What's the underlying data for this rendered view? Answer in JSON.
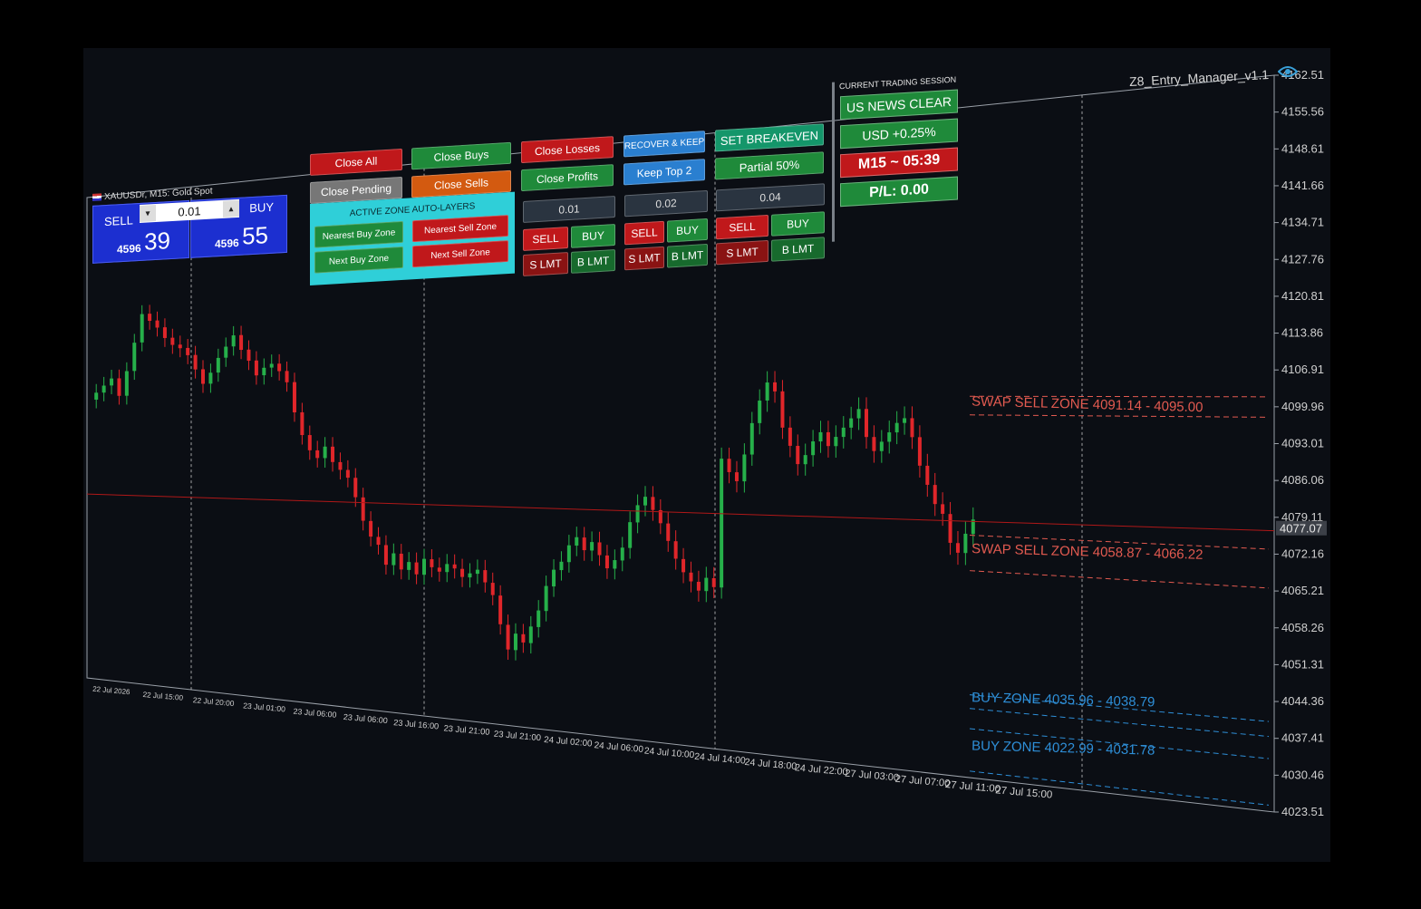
{
  "window": {
    "title": "Z8_Entry_Manager_v1.1",
    "symbol_header": "XAUUSDr, M15:  Gold Spot"
  },
  "one_click": {
    "sell_label": "SELL",
    "buy_label": "BUY",
    "lot": "0.01",
    "sell_small": "4596",
    "sell_big": "39",
    "buy_small": "4596",
    "buy_big": "55",
    "minus": "▾",
    "plus": "▴"
  },
  "panel": {
    "close_all": "Close All",
    "close_pending": "Close Pending",
    "close_buys": "Close Buys",
    "close_sells": "Close Sells",
    "close_losses": "Close Losses",
    "close_profits": "Close Profits",
    "recover_keep": "RECOVER & KEEP",
    "keep_top": "Keep Top 2",
    "set_breakeven": "SET BREAKEVEN",
    "partial": "Partial 50%",
    "zone_title": "ACTIVE ZONE AUTO-LAYERS",
    "nearest_buy": "Nearest Buy Zone",
    "nearest_sell": "Nearest Sell Zone",
    "next_buy": "Next Buy Zone",
    "next_sell": "Next Sell Zone",
    "lots": [
      {
        "lot": "0.01",
        "sell": "SELL",
        "buy": "BUY",
        "slmt": "S LMT",
        "blmt": "B LMT"
      },
      {
        "lot": "0.02",
        "sell": "SELL",
        "buy": "BUY",
        "slmt": "S LMT",
        "blmt": "B LMT"
      },
      {
        "lot": "0.04",
        "sell": "SELL",
        "buy": "BUY",
        "slmt": "S LMT",
        "blmt": "B LMT"
      }
    ],
    "session_title": "CURRENT TRADING SESSION",
    "news": "US NEWS CLEAR",
    "usd": "USD +0.25%",
    "timer": "M15 ~ 05:39",
    "pl": "P/L: 0.00"
  },
  "colors": {
    "bull": "#26b04a",
    "bear": "#e0262a",
    "sell_zone": "#e25a50",
    "buy_zone": "#2e8fd8",
    "price_line": "#b01818"
  },
  "chart_data": {
    "type": "candlestick",
    "current_price": "4077.07",
    "y_ticks": [
      "4162.51",
      "4155.56",
      "4148.61",
      "4141.66",
      "4134.71",
      "4127.76",
      "4120.81",
      "4113.86",
      "4106.91",
      "4099.96",
      "4093.01",
      "4086.06",
      "4079.11",
      "4072.16",
      "4065.21",
      "4058.26",
      "4051.31",
      "4044.36",
      "4037.41",
      "4030.46",
      "4023.51"
    ],
    "x_ticks": [
      "22 Jul 2026",
      "22 Jul 15:00",
      "22 Jul 20:00",
      "23 Jul 01:00",
      "23 Jul 06:00",
      "23 Jul 06:00",
      "23 Jul 16:00",
      "23 Jul 21:00",
      "23 Jul 21:00",
      "24 Jul 02:00",
      "24 Jul 06:00",
      "24 Jul 10:00",
      "24 Jul 14:00",
      "24 Jul 18:00",
      "24 Jul 22:00",
      "27 Jul 03:00",
      "27 Jul 07:00",
      "27 Jul 11:00",
      "27 Jul 15:00"
    ],
    "zones": [
      {
        "label": "SWAP SELL ZONE 4091.14 - 4095.00",
        "kind": "sell",
        "low": 4091.14,
        "high": 4095.0
      },
      {
        "label": "SWAP SELL ZONE 4058.87 - 4066.22",
        "kind": "sell",
        "low": 4058.87,
        "high": 4066.22
      },
      {
        "label": "BUY ZONE 4035.96 - 4038.79",
        "kind": "buy",
        "low": 4035.96,
        "high": 4038.79
      },
      {
        "label": "BUY ZONE 4022.99 - 4031.78",
        "kind": "buy",
        "low": 4022.99,
        "high": 4031.78
      }
    ],
    "closes": [
      4106,
      4108,
      4110,
      4105,
      4112,
      4120,
      4128,
      4126,
      4124,
      4121,
      4119,
      4118,
      4116,
      4112,
      4108,
      4111,
      4115,
      4118,
      4121,
      4117,
      4114,
      4110,
      4112,
      4113,
      4111,
      4108,
      4100,
      4094,
      4090,
      4088,
      4091,
      4087,
      4085,
      4083,
      4078,
      4072,
      4068,
      4066,
      4061,
      4064,
      4060,
      4062,
      4059,
      4063,
      4061,
      4060,
      4062,
      4061,
      4059,
      4060,
      4061,
      4058,
      4055,
      4048,
      4042,
      4046,
      4044,
      4048,
      4052,
      4058,
      4062,
      4064,
      4068,
      4070,
      4067,
      4069,
      4066,
      4063,
      4065,
      4068,
      4074,
      4078,
      4080,
      4077,
      4074,
      4070,
      4066,
      4063,
      4061,
      4059,
      4062,
      4060,
      4089,
      4086,
      4084,
      4090,
      4097,
      4102,
      4106,
      4104,
      4096,
      4092,
      4088,
      4090,
      4093,
      4095,
      4092,
      4094,
      4096,
      4098,
      4100,
      4094,
      4091,
      4093,
      4095,
      4097,
      4098,
      4094,
      4088,
      4084,
      4080,
      4078,
      4072,
      4070,
      4074,
      4077
    ]
  }
}
